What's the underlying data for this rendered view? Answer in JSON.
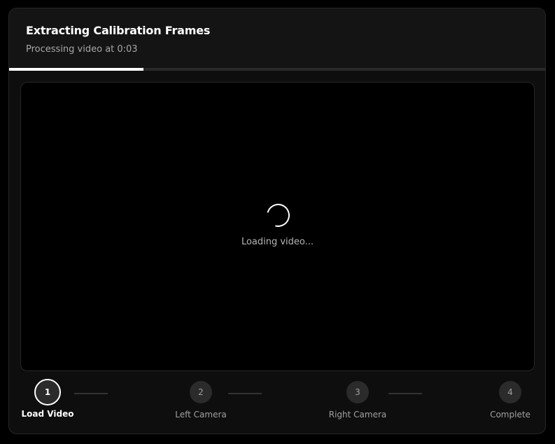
{
  "dialog": {
    "title": "Extracting Calibration Frames",
    "subtitle": "Processing video at 0:03",
    "progress_fraction": 0.25
  },
  "video": {
    "loading_text": "Loading video..."
  },
  "steps": [
    {
      "number": "1",
      "label": "Load Video",
      "state": "active"
    },
    {
      "number": "2",
      "label": "Left Camera",
      "state": "pending"
    },
    {
      "number": "3",
      "label": "Right Camera",
      "state": "pending"
    },
    {
      "number": "4",
      "label": "Complete",
      "state": "pending"
    }
  ],
  "colors": {
    "accent": "#ffffff",
    "background": "#000000",
    "panel": "#0e0e0e",
    "header": "#141414"
  }
}
